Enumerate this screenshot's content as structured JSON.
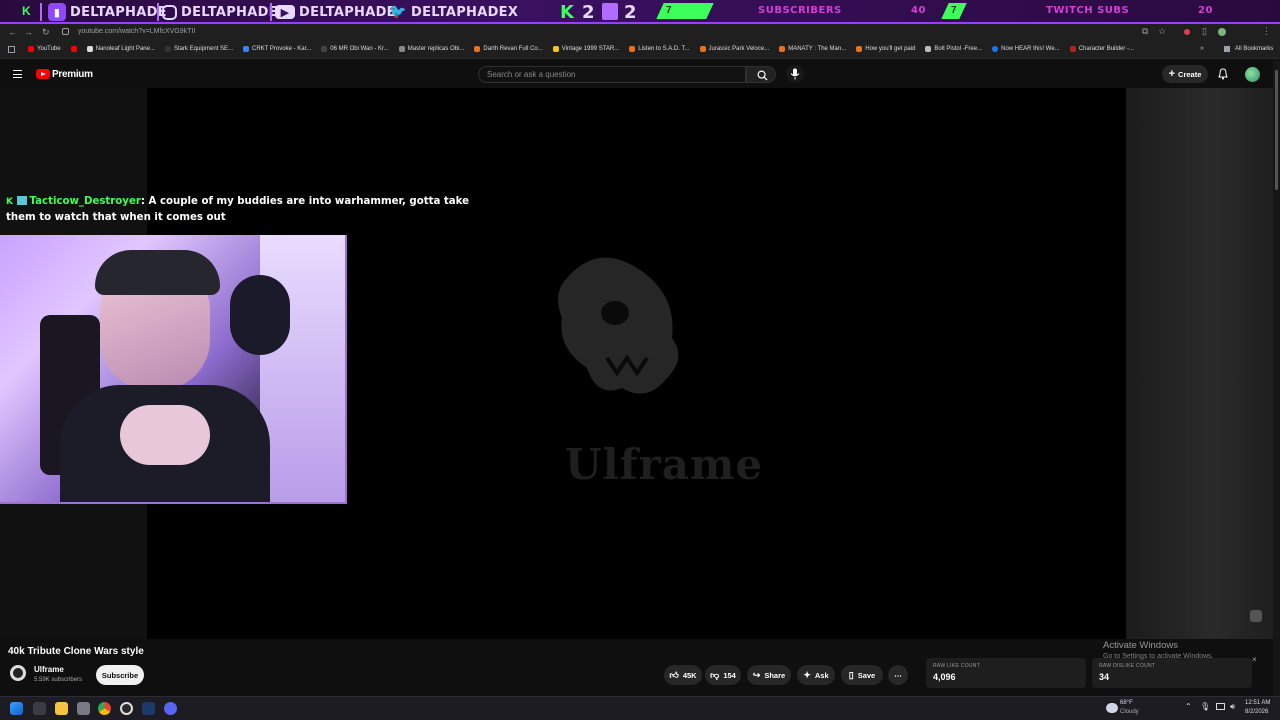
{
  "banner": {
    "socials": [
      {
        "platform": "twitch",
        "handle": "DELTAPHADE"
      },
      {
        "platform": "instagram",
        "handle": "DELTAPHADE"
      },
      {
        "platform": "youtube",
        "handle": "DELTAPHADE"
      },
      {
        "platform": "twitter",
        "handle": "DELTAPHADEX"
      }
    ],
    "k_count": "2",
    "twitch_count": "2",
    "counter_a": "7",
    "subscribers_label": "SUBSCRIBERS",
    "subscribers_goal": "40",
    "counter_b": "7",
    "twitch_subs_label": "TWITCH SUBS",
    "twitch_subs_goal": "20",
    "colors": {
      "purple": "#9b3cff",
      "green": "#3dff5a",
      "pink": "#d63dd9"
    }
  },
  "browser": {
    "url": "youtube.com/watch?v=LMfcXVG9kTII",
    "bookmarks": [
      "YouTube",
      "",
      "Nanoleaf Light Pane...",
      "Stark Equipment SE...",
      "CRKT Provoke - Kar...",
      "06 MR Obi Wan - Kr...",
      "Master replicas Obi...",
      "Darth Revan Full Co...",
      "Vintage 1999 STAR...",
      "Listen to S.A.D. T...",
      "Jurassic Park Veloce...",
      "MANATY : The Man...",
      "How you'll get paid",
      "Bolt Pistol -Free...",
      "Now HEAR this! We...",
      "Character Builder -..."
    ],
    "all_bookmarks": "All Bookmarks"
  },
  "youtube": {
    "logo": "Premium",
    "search_placeholder": "Search or ask a question",
    "create_label": "Create"
  },
  "chat": {
    "username": "Tacticow_Destroyer",
    "message": ": A couple of my buddies are into warhammer, gotta take them to watch that when it comes out"
  },
  "video": {
    "watermark": "Ulframe",
    "title": "40k Tribute Clone Wars style",
    "channel": "Ulframe",
    "subscribers": "5.59K subscribers",
    "subscribe_label": "Subscribe",
    "likes": "45K",
    "dislikes": "154",
    "share_label": "Share",
    "ask_label": "Ask",
    "save_label": "Save"
  },
  "extension": {
    "raw_like_label": "RAW LIKE COUNT",
    "raw_like_value": "4,096",
    "raw_dislike_label": "RAW DISLIKE COUNT",
    "raw_dislike_value": "34"
  },
  "windows": {
    "activate_title": "Activate Windows",
    "activate_sub": "Go to Settings to activate Windows.",
    "weather_temp": "68°F",
    "weather_desc": "Cloudy",
    "time": "12:51 AM",
    "date": "8/2/2026"
  }
}
